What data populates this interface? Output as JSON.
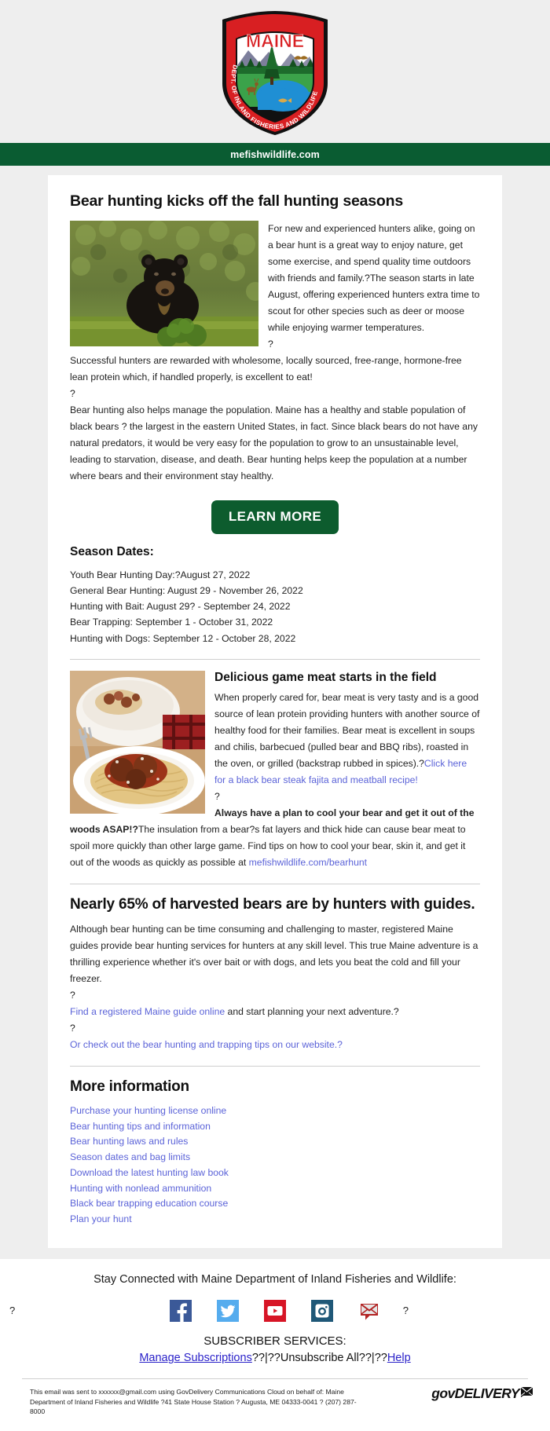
{
  "header": {
    "logo_alt": "Maine Dept. of Inland Fisheries and Wildlife crest",
    "crest_top_text": "MAINE",
    "crest_arc_text": "DEPT. OF INLAND FISHERIES AND WILDLIFE",
    "site_url": "mefishwildlife.com"
  },
  "article": {
    "headline": "Bear hunting kicks off the fall hunting seasons",
    "para1": "For new and experienced hunters alike, going on a bear hunt is a great way to enjoy nature, get some exercise, and spend quality time outdoors with friends and family.?The season starts in late August, offering experienced hunters extra time to scout for other species such as deer or moose while enjoying warmer temperatures.",
    "gap1": "?",
    "para2": "Successful hunters are rewarded with wholesome, locally sourced, free-range, hormone-free lean protein which, if handled properly, is excellent to eat!",
    "gap2": "?",
    "para3": "Bear hunting also helps manage the population. Maine has a healthy and stable population of black bears ? the largest in the eastern United States, in fact. Since black bears do not have any natural predators, it would be very easy for the population to grow to an unsustainable level, leading to starvation, disease, and death. Bear hunting helps keep the population at a number where bears and their environment stay healthy.",
    "learn_more_label": "LEARN MORE",
    "season_dates_heading": "Season Dates:",
    "season_dates": [
      "Youth Bear Hunting Day:?August 27, 2022",
      "General Bear Hunting: August 29 - November 26, 2022",
      "Hunting with Bait: August 29? - September 24, 2022",
      "Bear Trapping: September 1 - October 31, 2022",
      "Hunting with Dogs: September 12 - October 28, 2022"
    ]
  },
  "game_meat": {
    "heading": "Delicious game meat starts in the field",
    "para1_text": "When properly cared for, bear meat is very tasty and is a good source of lean protein providing hunters with another source of healthy food for their families. Bear meat is excellent in soups and chilis, barbecued (pulled bear and BBQ ribs), roasted in the oven, or grilled (backstrap rubbed in spices).?",
    "para1_link": "Click here for a black bear steak fajita and meatball recipe!",
    "gap": "?",
    "para2_bold": "Always have a plan to cool your bear and get it out of the woods ASAP!?",
    "para2_rest": "The insulation from a bear?s fat layers and thick hide can cause bear meat to spoil more quickly than other large game. Find tips on how to cool your bear, skin it, and get it out of the woods as quickly as possible at ",
    "para2_link": "mefishwildlife.com/bearhunt"
  },
  "guides": {
    "heading": "Nearly 65% of harvested bears are by hunters with guides.",
    "para": "Although bear hunting can be time consuming and challenging to master, registered Maine guides provide bear hunting services for hunters at any skill level. This true Maine adventure is a thrilling experience whether it's over bait or with dogs, and lets you beat the cold and fill your freezer.",
    "gap1": "?",
    "link1": "Find a registered Maine guide online",
    "link1_after": " and start planning your next adventure.?",
    "gap2": "?",
    "link2": "Or check out the bear hunting and trapping tips on our website.?"
  },
  "more_information": {
    "heading": "More information",
    "links": [
      "Purchase your hunting license online",
      "Bear hunting tips and information",
      "Bear hunting laws and rules",
      "Season dates and bag limits",
      "Download the latest hunting law book",
      "Hunting with nonlead ammunition",
      "Black bear trapping education course",
      "Plan your hunt"
    ]
  },
  "footer": {
    "stay_connected": "Stay Connected with Maine Department of Inland Fisheries and Wildlife:",
    "left_placeholder": "?",
    "right_placeholder": "?",
    "social": [
      {
        "name": "facebook-icon",
        "label": "Facebook",
        "color": "#3b5998"
      },
      {
        "name": "twitter-icon",
        "label": "Twitter",
        "color": "#55acee"
      },
      {
        "name": "youtube-icon",
        "label": "YouTube",
        "color": "#d71526"
      },
      {
        "name": "instagram-icon",
        "label": "Instagram",
        "color": "#1f5878"
      },
      {
        "name": "email-icon",
        "label": "Email",
        "color": "#b32424"
      }
    ],
    "subscriber_services_label": "SUBSCRIBER SERVICES:",
    "manage_subscriptions": "Manage Subscriptions",
    "sep1": "??|??",
    "unsubscribe_all": "Unsubscribe All??|??",
    "help": "Help",
    "legal": "This email was sent to xxxxxx@gmail.com using GovDelivery Communications Cloud on behalf of: Maine Department of Inland Fisheries and Wildlife ?41 State House Station ? Augusta, ME 04333-0041 ? (207) 287-8000",
    "govdelivery": "govDELIVERY"
  },
  "colors": {
    "brand_green": "#0a5c32",
    "button_green": "#0d5c2e",
    "link_purple": "#5b63d8",
    "page_bg": "#eeeeee"
  }
}
